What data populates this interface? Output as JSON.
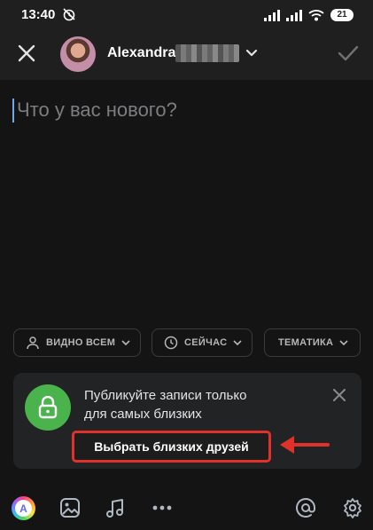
{
  "status_bar": {
    "time": "13:40",
    "battery": "21"
  },
  "header": {
    "user_name": "Alexandra",
    "icons": [
      "close-icon",
      "avatar",
      "chevron-down-icon",
      "checkmark-icon"
    ]
  },
  "post": {
    "placeholder": "Что у вас нового?",
    "value": ""
  },
  "options": {
    "audience_label": "ВИДНО ВСЕМ",
    "time_label": "СЕЙЧАС",
    "topic_label": "ТЕМАТИКА"
  },
  "promo": {
    "text_line1": "Публикуйте записи только",
    "text_line2": "для самых близких",
    "button_label": "Выбрать близких друзей",
    "highlight_color": "#e0322b",
    "lock_color": "#4bb34b"
  },
  "toolbar": {
    "icons": [
      "vk-a-icon",
      "image-icon",
      "music-icon",
      "more-icon",
      "mention-icon",
      "settings-icon"
    ]
  },
  "colors": {
    "background": "#141414",
    "header": "#1f1f1f",
    "accent_caret": "#71aaeb"
  }
}
